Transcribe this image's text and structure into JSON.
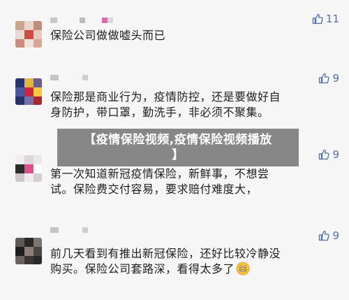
{
  "banner": {
    "line1": "【疫情保险视频,疫情保险视频播放",
    "line2": "】"
  },
  "comments": [
    {
      "likes": "11",
      "text_line1": "保险公司做做嘘头而已",
      "text_line2": ""
    },
    {
      "likes": "9",
      "text_line1": "保险那是商业行为，疫情防控，还是要做好自",
      "text_line2": "身防护，带口罩，勤洗手，非必须不聚集。"
    },
    {
      "likes": "9",
      "text_line1": "第一次知道新冠疫情保险，新鲜事，不想尝",
      "text_line2": "试。保险费交付容易，要求赔付难度大，"
    },
    {
      "likes": "9",
      "text_line1": "前几天看到有推出新冠保险，还好比较冷静没",
      "text_line2": "购买。保险公司套路深，看得太多了"
    }
  ],
  "icons": {
    "like": "thumbs-up-icon",
    "emoji": "grinning-face-emoji"
  },
  "colors": {
    "like_accent": "#4e6fa3",
    "banner_bg": "#787878"
  }
}
